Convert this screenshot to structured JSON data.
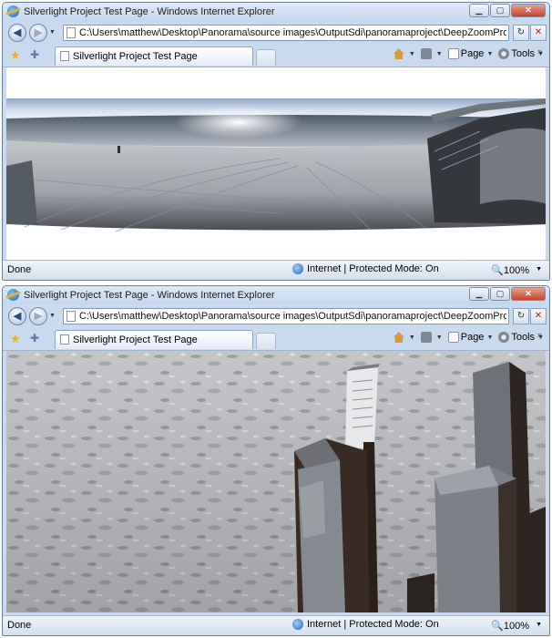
{
  "windows": [
    {
      "title": "Silverlight Project Test Page - Windows Internet Explorer",
      "address": "C:\\Users\\matthew\\Desktop\\Panorama\\source images\\OutputSdi\\panoramaproject\\DeepZoomProjectWeb\\ClientBin\\",
      "tab_label": "Silverlight Project Test Page",
      "commands": {
        "page": "Page",
        "tools": "Tools"
      },
      "status": "Done",
      "zone": "Internet | Protected Mode: On",
      "zoom": "100%",
      "content": "panorama-beach"
    },
    {
      "title": "Silverlight Project Test Page - Windows Internet Explorer",
      "address": "C:\\Users\\matthew\\Desktop\\Panorama\\source images\\OutputSdi\\panoramaproject\\DeepZoomProjectWeb\\ClientBin\\",
      "tab_label": "Silverlight Project Test Page",
      "commands": {
        "page": "Page",
        "tools": "Tools"
      },
      "status": "Done",
      "zone": "Internet | Protected Mode: On",
      "zoom": "100%",
      "content": "zoomed-sand"
    }
  ],
  "colors": {
    "frame": "#c9d9ee",
    "frame_border": "#6b7f9a"
  }
}
